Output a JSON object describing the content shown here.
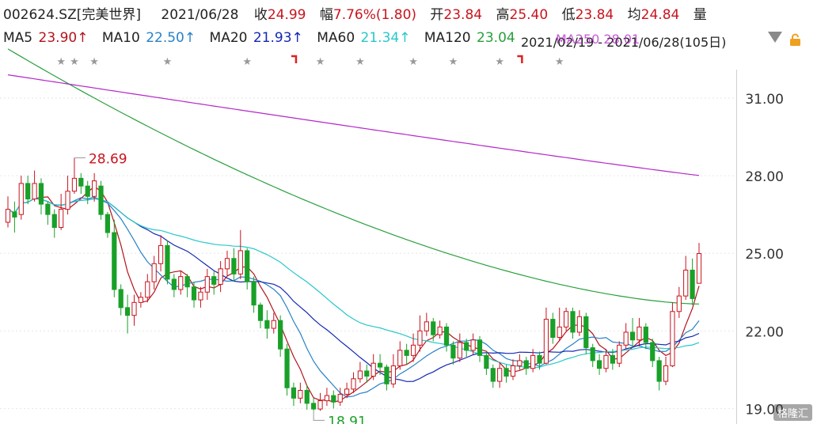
{
  "header": {
    "code": "002624.SZ[完美世界]",
    "date": "2021/06/28",
    "close_label": "收",
    "close": "24.99",
    "change_label": "幅",
    "change": "7.76%(1.80)",
    "open_label": "开",
    "open": "23.84",
    "high_label": "高",
    "high": "25.40",
    "low_label": "低",
    "low": "23.84",
    "avg_label": "均",
    "avg": "24.84",
    "vol_label": "量"
  },
  "ma_row": {
    "ma5_label": "MA5",
    "ma5_value": "23.90↑",
    "ma10_label": "MA10",
    "ma10_value": "22.50↑",
    "ma20_label": "MA20",
    "ma20_value": "21.93↑",
    "ma60_label": "MA60",
    "ma60_value": "21.34↑",
    "ma120_label": "MA120",
    "ma120_value": "23.04",
    "range_text": "2021/02/19 - 2021/06/28(105日)",
    "overlap_text": "MA250 28.01"
  },
  "colors": {
    "up": "#c8141e",
    "down": "#19a028",
    "ma5": "#b4141e",
    "ma10": "#2882c8",
    "ma20": "#1428b4",
    "ma60": "#28c8c8",
    "ma120": "#28a03c",
    "ma250": "#b428c8"
  },
  "icons": [
    "dropdown-triangle-icon",
    "lock-icon",
    "star-icon"
  ],
  "watermark": "格隆汇",
  "chart_data": {
    "type": "candlestick",
    "period_start": "2021/02/19",
    "period_end": "2021/06/28",
    "ylim": [
      18.9,
      32.0
    ],
    "y_ticks": [
      31.0,
      28.0,
      25.0,
      22.0,
      19.0
    ],
    "y_tick_labels": [
      "31.00",
      "28.00",
      "25.00",
      "22.00",
      "19.00"
    ],
    "annotations": [
      {
        "label": "28.69",
        "value": 28.69,
        "kind": "high"
      },
      {
        "label": "18.91",
        "value": 18.91,
        "kind": "low"
      }
    ],
    "candles": [
      [
        26.2,
        26.7,
        27.2,
        26.0
      ],
      [
        26.6,
        26.4,
        27.0,
        25.8
      ],
      [
        26.5,
        27.7,
        28.0,
        26.3
      ],
      [
        27.7,
        27.1,
        28.0,
        26.9
      ],
      [
        27.1,
        27.7,
        28.2,
        27.0
      ],
      [
        27.7,
        26.9,
        27.9,
        26.5
      ],
      [
        26.9,
        26.5,
        27.0,
        26.1
      ],
      [
        26.5,
        26.0,
        26.7,
        25.6
      ],
      [
        26.0,
        26.7,
        27.3,
        25.9
      ],
      [
        26.7,
        27.4,
        28.0,
        26.5
      ],
      [
        27.4,
        27.9,
        28.69,
        27.3
      ],
      [
        27.9,
        27.6,
        28.1,
        27.3
      ],
      [
        27.6,
        27.2,
        27.8,
        26.9
      ],
      [
        27.2,
        27.8,
        28.1,
        27.0
      ],
      [
        27.6,
        26.5,
        27.8,
        26.3
      ],
      [
        26.5,
        25.8,
        26.6,
        25.6
      ],
      [
        25.8,
        23.6,
        26.3,
        23.3
      ],
      [
        23.6,
        22.9,
        23.8,
        22.6
      ],
      [
        22.9,
        22.6,
        23.4,
        21.9
      ],
      [
        22.6,
        23.1,
        23.4,
        22.2
      ],
      [
        23.1,
        23.3,
        23.5,
        22.9
      ],
      [
        23.3,
        23.9,
        24.2,
        23.1
      ],
      [
        23.9,
        24.6,
        24.9,
        23.6
      ],
      [
        24.6,
        25.3,
        25.7,
        24.3
      ],
      [
        25.3,
        24.0,
        25.5,
        23.8
      ],
      [
        24.0,
        23.6,
        24.2,
        23.3
      ],
      [
        23.6,
        24.1,
        24.3,
        23.4
      ],
      [
        24.1,
        23.7,
        24.2,
        23.3
      ],
      [
        23.7,
        23.2,
        23.9,
        22.9
      ],
      [
        23.2,
        23.5,
        23.7,
        22.9
      ],
      [
        23.5,
        24.1,
        24.4,
        23.2
      ],
      [
        24.1,
        23.8,
        24.3,
        23.4
      ],
      [
        23.8,
        24.4,
        24.7,
        23.5
      ],
      [
        24.4,
        24.8,
        25.1,
        24.1
      ],
      [
        24.8,
        24.2,
        25.2,
        23.9
      ],
      [
        24.2,
        25.1,
        25.9,
        24.0
      ],
      [
        25.1,
        23.9,
        25.2,
        23.6
      ],
      [
        23.9,
        23.0,
        24.1,
        22.7
      ],
      [
        23.0,
        22.4,
        23.1,
        22.1
      ],
      [
        22.4,
        22.1,
        22.8,
        21.7
      ],
      [
        22.1,
        22.4,
        22.7,
        21.9
      ],
      [
        22.4,
        21.3,
        22.6,
        21.0
      ],
      [
        21.3,
        19.8,
        21.5,
        19.5
      ],
      [
        19.8,
        19.4,
        20.0,
        19.1
      ],
      [
        19.4,
        19.7,
        20.0,
        19.2
      ],
      [
        19.7,
        19.2,
        19.9,
        18.95
      ],
      [
        19.2,
        18.98,
        19.4,
        18.91
      ],
      [
        18.98,
        19.3,
        19.6,
        18.91
      ],
      [
        19.3,
        19.5,
        19.8,
        19.1
      ],
      [
        19.5,
        19.25,
        19.7,
        19.0
      ],
      [
        19.25,
        19.55,
        19.8,
        19.1
      ],
      [
        19.55,
        19.75,
        20.0,
        19.4
      ],
      [
        19.75,
        20.15,
        20.4,
        19.6
      ],
      [
        20.15,
        20.45,
        20.8,
        20.0
      ],
      [
        20.45,
        20.25,
        20.7,
        20.0
      ],
      [
        20.25,
        20.75,
        21.1,
        20.1
      ],
      [
        20.75,
        20.6,
        21.1,
        20.3
      ],
      [
        20.6,
        19.95,
        20.7,
        19.7
      ],
      [
        19.95,
        20.65,
        21.1,
        19.8
      ],
      [
        20.65,
        21.25,
        21.6,
        20.5
      ],
      [
        21.25,
        21.05,
        21.5,
        20.7
      ],
      [
        21.05,
        21.45,
        21.9,
        20.8
      ],
      [
        21.45,
        22.0,
        22.6,
        21.2
      ],
      [
        22.0,
        22.35,
        22.7,
        21.8
      ],
      [
        22.35,
        21.85,
        22.5,
        21.6
      ],
      [
        21.85,
        22.15,
        22.4,
        21.7
      ],
      [
        22.15,
        21.45,
        22.3,
        21.2
      ],
      [
        21.45,
        20.95,
        21.6,
        20.7
      ],
      [
        20.95,
        21.55,
        21.9,
        20.8
      ],
      [
        21.55,
        21.25,
        21.7,
        21.0
      ],
      [
        21.25,
        21.65,
        21.9,
        21.1
      ],
      [
        21.65,
        21.05,
        21.8,
        20.8
      ],
      [
        21.05,
        20.55,
        21.2,
        20.3
      ],
      [
        20.55,
        20.05,
        20.7,
        19.8
      ],
      [
        20.05,
        20.55,
        20.8,
        19.8
      ],
      [
        20.55,
        20.25,
        20.7,
        20.0
      ],
      [
        20.25,
        20.65,
        20.9,
        20.1
      ],
      [
        20.65,
        20.85,
        21.1,
        20.5
      ],
      [
        20.85,
        20.55,
        21.0,
        20.3
      ],
      [
        20.55,
        21.05,
        21.3,
        20.4
      ],
      [
        21.05,
        20.75,
        21.2,
        20.5
      ],
      [
        20.75,
        22.45,
        22.9,
        20.7
      ],
      [
        22.45,
        21.75,
        22.7,
        21.5
      ],
      [
        21.75,
        22.15,
        22.9,
        21.6
      ],
      [
        22.15,
        22.75,
        22.9,
        22.0
      ],
      [
        22.75,
        21.95,
        22.9,
        21.7
      ],
      [
        21.95,
        22.55,
        22.8,
        21.8
      ],
      [
        22.55,
        21.35,
        22.7,
        21.1
      ],
      [
        21.35,
        20.85,
        21.5,
        20.6
      ],
      [
        20.85,
        20.55,
        21.1,
        20.3
      ],
      [
        20.55,
        21.05,
        21.3,
        20.4
      ],
      [
        21.05,
        20.75,
        21.3,
        20.5
      ],
      [
        20.75,
        21.45,
        21.6,
        20.6
      ],
      [
        21.45,
        21.95,
        22.3,
        21.3
      ],
      [
        21.95,
        21.65,
        22.5,
        21.4
      ],
      [
        21.65,
        22.15,
        22.5,
        21.4
      ],
      [
        22.15,
        21.55,
        22.3,
        21.3
      ],
      [
        21.55,
        20.85,
        21.7,
        20.6
      ],
      [
        20.85,
        20.05,
        21.0,
        19.7
      ],
      [
        20.05,
        20.65,
        21.0,
        19.9
      ],
      [
        20.65,
        22.75,
        23.1,
        20.6
      ],
      [
        22.75,
        23.35,
        23.7,
        22.5
      ],
      [
        23.35,
        24.35,
        24.9,
        23.2
      ],
      [
        24.35,
        23.25,
        24.8,
        23.0
      ],
      [
        23.84,
        24.99,
        25.4,
        23.84
      ]
    ],
    "ma_lines": [
      {
        "name": "MA5",
        "color": "#b4141e"
      },
      {
        "name": "MA10",
        "color": "#2882c8"
      },
      {
        "name": "MA20",
        "color": "#1428b4"
      },
      {
        "name": "MA60",
        "color": "#28c8c8"
      },
      {
        "name": "MA120",
        "color": "#28a03c",
        "from": 32.9,
        "to": 23.04
      },
      {
        "name": "MA250",
        "color": "#b428c8",
        "from": 31.9,
        "to": 28.01
      }
    ],
    "event_markers": [
      {
        "kind": "star",
        "candle_index": 8
      },
      {
        "kind": "star",
        "candle_index": 10
      },
      {
        "kind": "star",
        "candle_index": 13
      },
      {
        "kind": "star",
        "candle_index": 24
      },
      {
        "kind": "star",
        "candle_index": 36
      },
      {
        "kind": "flag",
        "candle_index": 43
      },
      {
        "kind": "star",
        "candle_index": 47
      },
      {
        "kind": "star",
        "candle_index": 53
      },
      {
        "kind": "star",
        "candle_index": 61
      },
      {
        "kind": "star",
        "candle_index": 67
      },
      {
        "kind": "star",
        "candle_index": 74
      },
      {
        "kind": "flag",
        "candle_index": 77
      },
      {
        "kind": "star",
        "candle_index": 83
      }
    ]
  }
}
